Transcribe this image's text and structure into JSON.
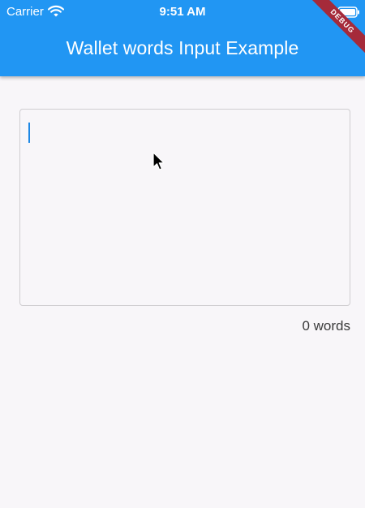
{
  "status_bar": {
    "carrier": "Carrier",
    "time": "9:51 AM"
  },
  "app_bar": {
    "title": "Wallet words Input Example",
    "color": "#2196f3"
  },
  "debug_banner": {
    "label": "DEBUG",
    "color": "#a52a3a"
  },
  "words_input": {
    "value": "",
    "word_count_label": "0 words"
  },
  "icons": [
    "wifi-icon",
    "battery-icon",
    "mouse-pointer-icon"
  ]
}
